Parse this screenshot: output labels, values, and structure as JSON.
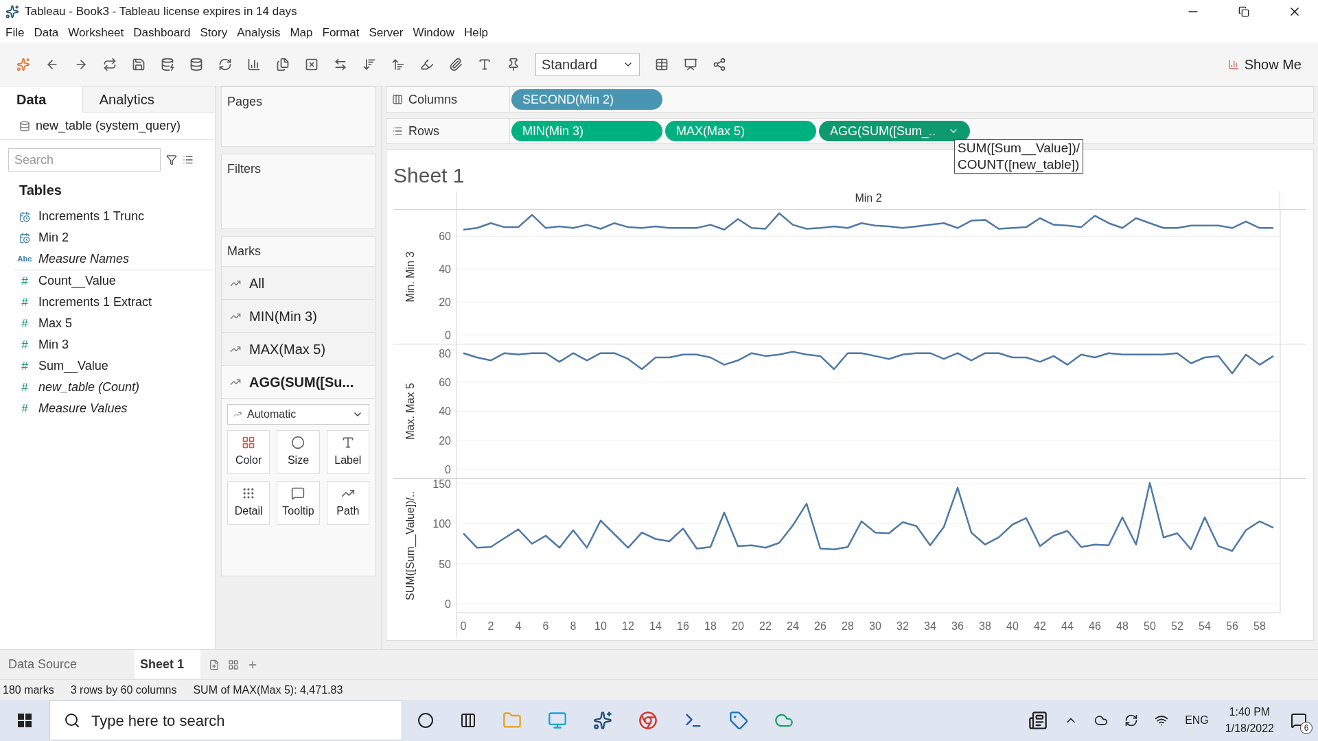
{
  "window": {
    "title": "Tableau - Book3 - Tableau license expires in 14 days"
  },
  "menu": [
    "File",
    "Data",
    "Worksheet",
    "Dashboard",
    "Story",
    "Analysis",
    "Map",
    "Format",
    "Server",
    "Window",
    "Help"
  ],
  "toolbar": {
    "view_size": "Standard",
    "show_me": "Show Me"
  },
  "data_pane": {
    "tabs": [
      {
        "label": "Data",
        "selected": true
      },
      {
        "label": "Analytics",
        "selected": false
      }
    ],
    "data_source": "new_table (system_query)",
    "search": {
      "placeholder": "Search"
    },
    "section": "Tables",
    "fields": [
      {
        "name": "Increments 1 Trunc",
        "kind": "date",
        "italic": false
      },
      {
        "name": "Min 2",
        "kind": "date",
        "italic": false
      },
      {
        "name": "Measure Names",
        "kind": "text",
        "type_label": "Abc",
        "italic": true
      },
      {
        "name": "Count__Value",
        "kind": "measure",
        "type_label": "#",
        "italic": false
      },
      {
        "name": "Increments 1 Extract",
        "kind": "measure",
        "type_label": "#",
        "italic": false
      },
      {
        "name": "Max 5",
        "kind": "measure",
        "type_label": "#",
        "italic": false
      },
      {
        "name": "Min 3",
        "kind": "measure",
        "type_label": "#",
        "italic": false
      },
      {
        "name": "Sum__Value",
        "kind": "measure",
        "type_label": "#",
        "italic": false
      },
      {
        "name": "new_table (Count)",
        "kind": "measure",
        "type_label": "#",
        "italic": true
      },
      {
        "name": "Measure Values",
        "kind": "measure",
        "type_label": "#",
        "italic": true
      }
    ]
  },
  "cards": {
    "pages": "Pages",
    "filters": "Filters",
    "marks": {
      "title": "Marks",
      "layers": [
        {
          "label": "All",
          "selected": false
        },
        {
          "label": "MIN(Min 3)",
          "selected": false
        },
        {
          "label": "MAX(Max 5)",
          "selected": false
        },
        {
          "label": "AGG(SUM([Su...",
          "selected": true
        }
      ],
      "mark_type": "Automatic",
      "buttons": [
        {
          "label": "Color",
          "kind": "color"
        },
        {
          "label": "Size",
          "kind": "size"
        },
        {
          "label": "Label",
          "kind": "label"
        },
        {
          "label": "Detail",
          "kind": "detail"
        },
        {
          "label": "Tooltip",
          "kind": "tooltip"
        },
        {
          "label": "Path",
          "kind": "path"
        }
      ]
    }
  },
  "shelves": {
    "columns": {
      "label": "Columns",
      "pills": [
        {
          "label": "SECOND(Min 2)",
          "kind": "discrete",
          "selected": false
        }
      ]
    },
    "rows": {
      "label": "Rows",
      "pills": [
        {
          "label": "MIN(Min 3)",
          "kind": "continuous",
          "selected": false
        },
        {
          "label": "MAX(Max 5)",
          "kind": "continuous",
          "selected": false
        },
        {
          "label": "AGG(SUM([Sum_..",
          "kind": "continuous",
          "selected": true
        }
      ]
    },
    "tooltip": [
      "SUM([Sum__Value])/",
      "COUNT([new_table])"
    ]
  },
  "sheet": {
    "title": "Sheet 1",
    "header": "Min 2",
    "panels": [
      {
        "chart_data": {
          "type": "line",
          "ylabel": "Min. Min 3",
          "ylim": [
            0,
            76
          ],
          "yticks": [
            0,
            20,
            40,
            60
          ],
          "grid": true,
          "series": [
            {
              "color": "#4e79a7",
              "values": [
                64,
                65,
                68,
                65.5,
                65.5,
                73,
                65,
                66,
                65,
                67,
                64.5,
                68,
                65.5,
                65,
                66,
                65,
                65,
                65,
                67,
                64,
                70.5,
                65,
                64.5,
                74,
                67,
                64.5,
                65,
                66,
                65,
                68,
                66.5,
                66,
                65,
                66,
                67,
                68,
                65,
                69.5,
                70,
                64.5,
                65,
                65.5,
                71,
                67,
                66.5,
                65.5,
                72.5,
                68,
                65,
                71,
                68,
                65,
                65,
                66.5,
                66.5,
                66.5,
                65,
                69,
                65,
                65
              ]
            }
          ]
        }
      },
      {
        "chart_data": {
          "type": "line",
          "ylabel": "Max. Max 5",
          "ylim": [
            0,
            86
          ],
          "yticks": [
            0,
            20,
            40,
            60,
            80
          ],
          "grid": true,
          "series": [
            {
              "color": "#4e79a7",
              "values": [
                80,
                77,
                75,
                80,
                79,
                80,
                80,
                74,
                80,
                75,
                80,
                80,
                76,
                69,
                77,
                77,
                79,
                79,
                77,
                72,
                75,
                80,
                78,
                79,
                81,
                79,
                78,
                69,
                80,
                80,
                78,
                76,
                79,
                80,
                80,
                76,
                80,
                75,
                80,
                80,
                77,
                77,
                74,
                78,
                72,
                79,
                77,
                80,
                79,
                79,
                79,
                79,
                80,
                73,
                77,
                78,
                66,
                79,
                72,
                78
              ]
            }
          ]
        }
      },
      {
        "chart_data": {
          "type": "line",
          "ylabel": "SUM([Sum__Value])/..",
          "ylim": [
            0,
            156
          ],
          "yticks": [
            0,
            50,
            100,
            150
          ],
          "grid": true,
          "xlim": [
            -0.5,
            59.5
          ],
          "x": [
            0,
            1,
            2,
            3,
            4,
            5,
            6,
            7,
            8,
            9,
            10,
            11,
            12,
            13,
            14,
            15,
            16,
            17,
            18,
            19,
            20,
            21,
            22,
            23,
            24,
            25,
            26,
            27,
            28,
            29,
            30,
            31,
            32,
            33,
            34,
            35,
            36,
            37,
            38,
            39,
            40,
            41,
            42,
            43,
            44,
            45,
            46,
            47,
            48,
            49,
            50,
            51,
            52,
            53,
            54,
            55,
            56,
            57,
            58,
            59
          ],
          "xticks": [
            0,
            2,
            4,
            6,
            8,
            10,
            12,
            14,
            16,
            18,
            20,
            22,
            24,
            26,
            28,
            30,
            32,
            34,
            36,
            38,
            40,
            42,
            44,
            46,
            48,
            50,
            52,
            54,
            56,
            58
          ],
          "series": [
            {
              "color": "#4e79a7",
              "values": [
                88,
                70,
                71,
                82,
                93,
                75,
                85,
                70,
                92,
                70,
                104,
                87,
                70,
                89,
                81,
                78,
                94,
                69,
                71,
                114,
                72,
                73,
                70,
                76,
                98,
                125,
                69,
                68,
                71,
                103,
                89,
                88,
                102,
                97,
                73,
                96,
                145,
                89,
                74,
                83,
                99,
                107,
                72,
                85,
                91,
                71,
                74,
                73,
                108,
                74,
                151,
                83,
                88,
                68,
                108,
                72,
                66,
                92,
                103,
                95
              ]
            }
          ]
        }
      }
    ]
  },
  "sheet_tabs": [
    {
      "label": "Data Source",
      "selected": false
    },
    {
      "label": "Sheet 1",
      "selected": true
    }
  ],
  "status_bar": [
    "180 marks",
    "3 rows by 60 columns",
    "SUM of MAX(Max 5): 4,471.83"
  ],
  "taskbar": {
    "search_placeholder": "Type here to search",
    "language": "ENG",
    "time": "1:40 PM",
    "date": "1/18/2022",
    "notifications": "6"
  }
}
